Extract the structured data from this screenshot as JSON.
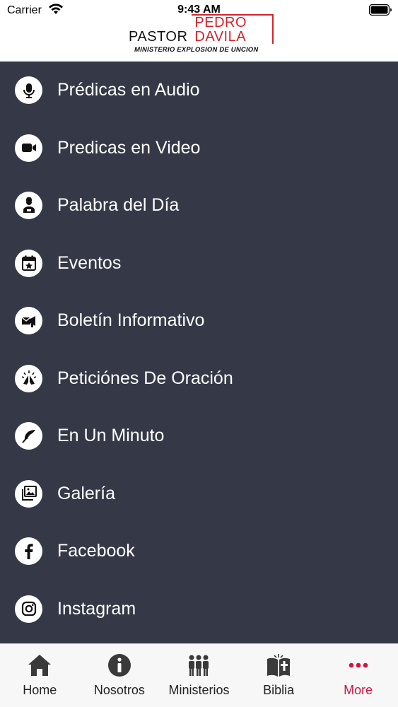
{
  "status_bar": {
    "carrier": "Carrier",
    "time": "9:43 AM",
    "wifi_icon": "wifi-icon",
    "battery_icon": "battery-icon"
  },
  "header": {
    "logo_line1_left": "PASTOR",
    "logo_line1_right": "PEDRO DAVILA",
    "logo_subtitle": "MINISTERIO EXPLOSION DE UNCION",
    "brand_color": "#d5232b"
  },
  "menu": {
    "background": "#353947",
    "items": [
      {
        "label": "Prédicas en Audio",
        "icon": "microphone-icon"
      },
      {
        "label": "Predicas en Video",
        "icon": "video-camera-icon"
      },
      {
        "label": "Palabra del Día",
        "icon": "preacher-icon"
      },
      {
        "label": "Eventos",
        "icon": "calendar-star-icon"
      },
      {
        "label": "Boletín Informativo",
        "icon": "newsletter-icon"
      },
      {
        "label": "Peticiónes De Oración",
        "icon": "praying-hands-icon"
      },
      {
        "label": "En Un Minuto",
        "icon": "feather-icon"
      },
      {
        "label": "Galería",
        "icon": "gallery-icon"
      },
      {
        "label": "Facebook",
        "icon": "facebook-icon"
      },
      {
        "label": "Instagram",
        "icon": "instagram-icon"
      }
    ]
  },
  "tabbar": {
    "active_color": "#d5123f",
    "tabs": [
      {
        "label": "Home",
        "icon": "home-icon"
      },
      {
        "label": "Nosotros",
        "icon": "info-icon"
      },
      {
        "label": "Ministerios",
        "icon": "people-group-icon"
      },
      {
        "label": "Biblia",
        "icon": "bible-icon"
      },
      {
        "label": "More",
        "icon": "more-dots-icon",
        "active": true
      }
    ]
  }
}
